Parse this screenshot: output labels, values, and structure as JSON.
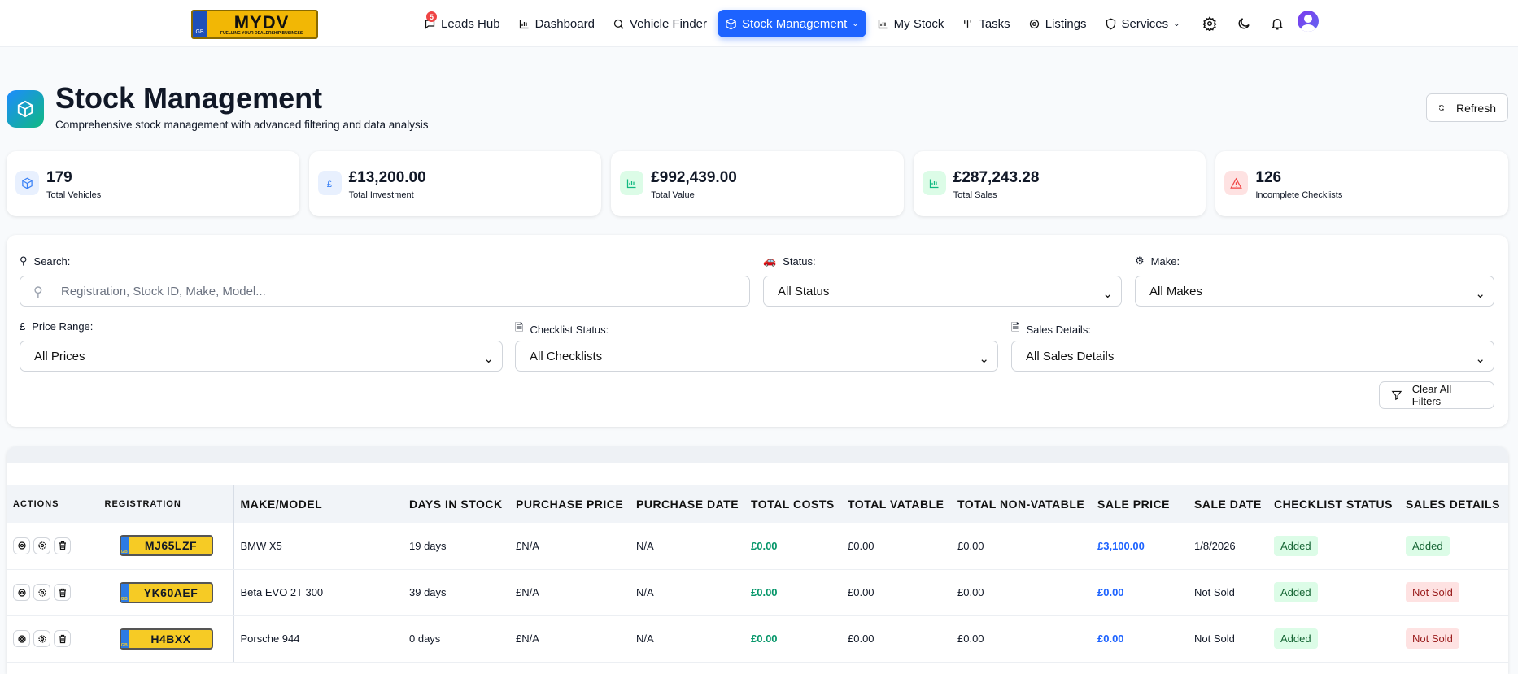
{
  "brand": {
    "logo_text": "MYDV",
    "logo_tagline": "FUELLING YOUR DEALERSHIP BUSINESS",
    "logo_country": "GB"
  },
  "nav": {
    "items": [
      {
        "label": "Leads Hub",
        "icon": "chat-icon",
        "badge": "5"
      },
      {
        "label": "Dashboard",
        "icon": "bar-chart-icon"
      },
      {
        "label": "Vehicle Finder",
        "icon": "search-icon"
      },
      {
        "label": "Stock Management",
        "icon": "box-icon",
        "active": true
      },
      {
        "label": "My Stock",
        "icon": "bar-chart-icon"
      },
      {
        "label": "Tasks",
        "icon": "tasks-icon"
      },
      {
        "label": "Listings",
        "icon": "gear-icon"
      },
      {
        "label": "Services",
        "icon": "shield-icon"
      }
    ]
  },
  "header": {
    "title": "Stock Management",
    "subtitle": "Comprehensive stock management with advanced filtering and data analysis",
    "refresh_label": "Refresh"
  },
  "stats": [
    {
      "value": "179",
      "label": "Total Vehicles",
      "color": "#3b82f6"
    },
    {
      "value": "£13,200.00",
      "label": "Total Investment",
      "color": "#3b82f6"
    },
    {
      "value": "£992,439.00",
      "label": "Total Value",
      "color": "#10b981"
    },
    {
      "value": "£287,243.28",
      "label": "Total Sales",
      "color": "#10b981"
    },
    {
      "value": "126",
      "label": "Incomplete Checklists",
      "color": "#ef4444"
    }
  ],
  "filters": {
    "search_label": "Search:",
    "search_placeholder": "Registration, Stock ID, Make, Model...",
    "status_label": "Status:",
    "status_value": "All Status",
    "make_label": "Make:",
    "make_value": "All Makes",
    "price_label": "Price Range:",
    "price_value": "All Prices",
    "checklist_label": "Checklist Status:",
    "checklist_value": "All Checklists",
    "sales_label": "Sales Details:",
    "sales_value": "All Sales Details",
    "clear_label": "Clear All Filters"
  },
  "table": {
    "columns": [
      "ACTIONS",
      "REGISTRATION",
      "MAKE/MODEL",
      "DAYS IN STOCK",
      "PURCHASE PRICE",
      "PURCHASE DATE",
      "TOTAL COSTS",
      "TOTAL VATABLE",
      "TOTAL NON-VATABLE",
      "SALE PRICE",
      "SALE DATE",
      "CHECKLIST STATUS",
      "SALES DETAILS"
    ],
    "rows": [
      {
        "reg": "MJ65LZF",
        "make": "BMW X5",
        "days": "19 days",
        "pp": "£N/A",
        "pd": "N/A",
        "tc": "£0.00",
        "tv": "£0.00",
        "tnv": "£0.00",
        "sp": "£3,100.00",
        "sd": "1/8/2026",
        "cs": "Added",
        "sdet": "Added"
      },
      {
        "reg": "YK60AEF",
        "make": "Beta EVO 2T 300",
        "days": "39 days",
        "pp": "£N/A",
        "pd": "N/A",
        "tc": "£0.00",
        "tv": "£0.00",
        "tnv": "£0.00",
        "sp": "£0.00",
        "sd": "Not Sold",
        "cs": "Added",
        "sdet": "Not Sold"
      },
      {
        "reg": "H4BXX",
        "make": "Porsche 944",
        "days": "0 days",
        "pp": "£N/A",
        "pd": "N/A",
        "tc": "£0.00",
        "tv": "£0.00",
        "tnv": "£0.00",
        "sp": "£0.00",
        "sd": "Not Sold",
        "cs": "Added",
        "sdet": "Not Sold"
      }
    ]
  }
}
